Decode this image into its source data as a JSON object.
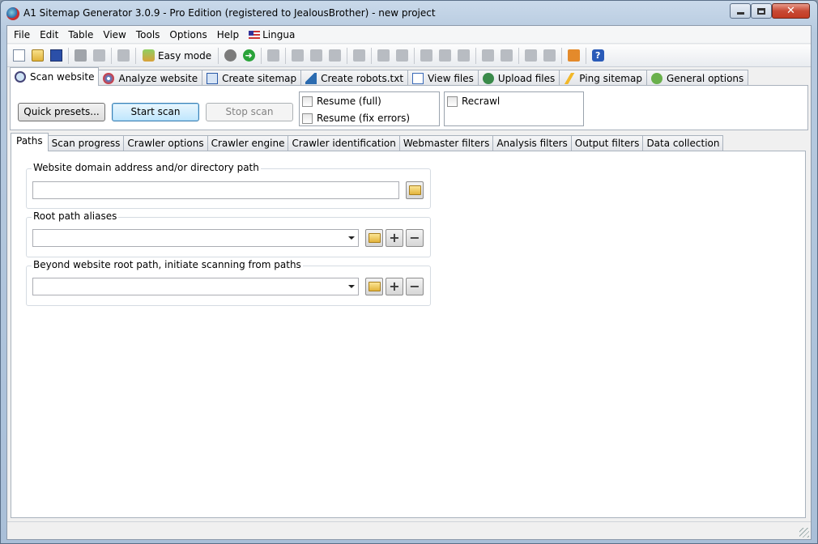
{
  "window": {
    "title": "A1 Sitemap Generator 3.0.9 - Pro Edition (registered to JealousBrother) - new project"
  },
  "menu": [
    "File",
    "Edit",
    "Table",
    "View",
    "Tools",
    "Options",
    "Help"
  ],
  "menu_lingua": "Lingua",
  "toolbar": {
    "easy_mode": "Easy mode",
    "icons": [
      "new-document-icon",
      "open-folder-icon",
      "save-icon",
      "copy-project-icon",
      "paste-project-icon",
      "print-icon",
      "record-icon",
      "go-icon",
      "refresh-icon",
      "cut-icon",
      "copy-icon",
      "paste-icon",
      "undo-icon",
      "search-icon",
      "search-next-icon",
      "align-left-icon",
      "indent-icon",
      "table-icon",
      "move-right-icon",
      "move-next-icon",
      "expand-icon",
      "collapse-icon",
      "home-icon",
      "help-icon"
    ]
  },
  "main_tabs": [
    {
      "label": "Scan website",
      "icon": "magnifier-icon"
    },
    {
      "label": "Analyze website",
      "icon": "analyze-icon"
    },
    {
      "label": "Create sitemap",
      "icon": "sitemap-icon"
    },
    {
      "label": "Create robots.txt",
      "icon": "filter-icon"
    },
    {
      "label": "View files",
      "icon": "files-icon"
    },
    {
      "label": "Upload files",
      "icon": "upload-icon"
    },
    {
      "label": "Ping sitemap",
      "icon": "lightning-icon"
    },
    {
      "label": "General options",
      "icon": "options-icon"
    }
  ],
  "scan": {
    "quick_presets": "Quick presets...",
    "start_scan": "Start scan",
    "stop_scan": "Stop scan",
    "resume_full": "Resume (full)",
    "resume_fix_errors": "Resume (fix errors)",
    "recrawl": "Recrawl"
  },
  "sub_tabs": [
    "Paths",
    "Scan progress",
    "Crawler options",
    "Crawler engine",
    "Crawler identification",
    "Webmaster filters",
    "Analysis filters",
    "Output filters",
    "Data collection"
  ],
  "paths": {
    "domain_label": "Website domain address and/or directory path",
    "domain_value": "",
    "aliases_label": "Root path aliases",
    "aliases_value": "",
    "beyond_label": "Beyond website root path, initiate scanning from paths",
    "beyond_value": ""
  }
}
